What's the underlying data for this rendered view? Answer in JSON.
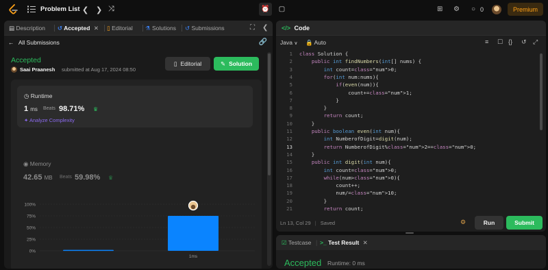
{
  "nav": {
    "title": "Problem List",
    "streak_count": "0",
    "premium_label": "Premium"
  },
  "left_tabs": [
    {
      "label": "Description"
    },
    {
      "label": "Accepted"
    },
    {
      "label": "Editorial"
    },
    {
      "label": "Solutions"
    },
    {
      "label": "Submissions"
    }
  ],
  "submission": {
    "back_label": "All Submissions",
    "status": "Accepted",
    "user": "Saai Praanesh",
    "meta": "submitted at Aug 17, 2024 08:50",
    "editorial_button": "Editorial",
    "solution_button": "Solution"
  },
  "runtime": {
    "label": "Runtime",
    "value": "1",
    "unit": "ms",
    "beats_label": "Beats",
    "beats": "98.71%",
    "analyze": "Analyze Complexity"
  },
  "memory": {
    "label": "Memory",
    "value": "42.65",
    "unit": "MB",
    "beats_label": "Beats",
    "beats": "59.98%"
  },
  "chart_data": {
    "type": "bar",
    "categories": [
      "",
      "1ms"
    ],
    "values": [
      2,
      75
    ],
    "highlight_index": 1,
    "xlabel": "",
    "ylabel": "",
    "ylim": [
      0,
      100
    ],
    "yticks": [
      "0%",
      "25%",
      "50%",
      "75%",
      "100%"
    ],
    "grid": true,
    "bar_color": "#0a84ff"
  },
  "editor": {
    "tab_label": "Code",
    "language": "Java",
    "mode": "Auto",
    "status": "Ln 13, Col 29",
    "saved": "Saved",
    "run_label": "Run",
    "submit_label": "Submit",
    "current_line": 13,
    "lines": [
      "class Solution {",
      "    public int findNumbers(int[] nums) {",
      "        int count=0;",
      "        for(int num:nums){",
      "            if(even(num)){",
      "                count+=1;",
      "            }",
      "        }",
      "        return count;",
      "    }",
      "    public boolean even(int num){",
      "        int NumberofDigit=digit(num);",
      "        return NumberofDigit%2==0;",
      "    }",
      "    public int digit(int num){",
      "        int count=0;",
      "        while(num>0){",
      "            count++;",
      "            num/=10;",
      "        }",
      "        return count;"
    ]
  },
  "result": {
    "tab_testcase": "Testcase",
    "tab_result": "Test Result",
    "status": "Accepted",
    "runtime": "Runtime: 0 ms"
  }
}
